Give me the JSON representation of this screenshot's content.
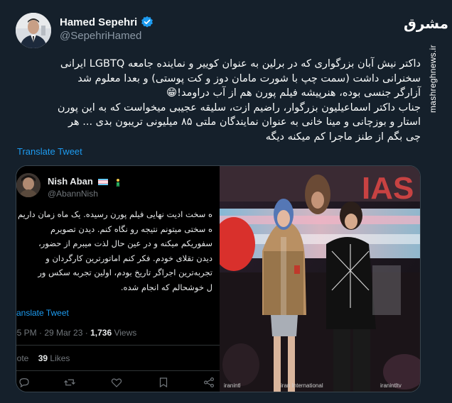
{
  "author": {
    "display_name": "Hamed Sepehri",
    "handle": "@SepehriHamed",
    "verified_icon": "verified-badge-icon"
  },
  "brand": {
    "logo_text": "مشرق",
    "url": "mashreghnews.ir"
  },
  "tweet": {
    "lines": [
      "داکتر نیش آبان بزرگواری که در برلین به عنوان کوییر و نماینده جامعه LGBTQ ایرانی",
      "سخنرانی داشت (سمت چپ با شورت مامان دوز و کت پوستی) و بعدا معلوم شد",
      "آزارگر جنسی بوده، هنرپیشه فیلم پورن هم از آب دراومد!😁",
      "جناب داکتر اسماعیلیون بزرگوار، راضیم ازت، سلیقه عجیبی میخواست که به این پورن",
      "استار و بوزچانی و مینا خانی به عنوان نمایندگان ملتی ۸۵ میلیونی تریبون بدی ... هر",
      "چی بگم از طنز ماجرا کم میکنه دیگه"
    ],
    "translate_label": "Translate Tweet"
  },
  "embedded": {
    "name": "Nish Aban",
    "handle": "@AbannNish",
    "lines": [
      "ه سخت ادیت نهایی فیلم پورن رسیده. یک ماه زمان داریم",
      "ه سختی میتونم نتیجه رو نگاه کنم. دیدن تصویرم",
      "سفوریکم میکنه و در عین حال لذت میبرم از حضور،",
      "دیدن تقلای خودم. فکر کنم اماتورترین کارگردان و",
      "تجربه‌ترین اجراگر تاریخ بودم، اولین تجربه سکس ور",
      "ل خوشحالم که انجام شده."
    ],
    "translate_label": "ranslate Tweet",
    "time": "05 PM",
    "date": "29 Mar 23",
    "views_count": "1,736",
    "views_label": "Views",
    "quotes_label": "uote",
    "likes_count": "39",
    "likes_label": "Likes"
  },
  "photo": {
    "banner_text": "IAS",
    "watermark_left": "iranintl",
    "watermark_right": "iranintltv",
    "watermark_brand": "iran International"
  },
  "colors": {
    "background": "#15202b",
    "link": "#1d9bf0",
    "muted": "#8b98a5"
  }
}
